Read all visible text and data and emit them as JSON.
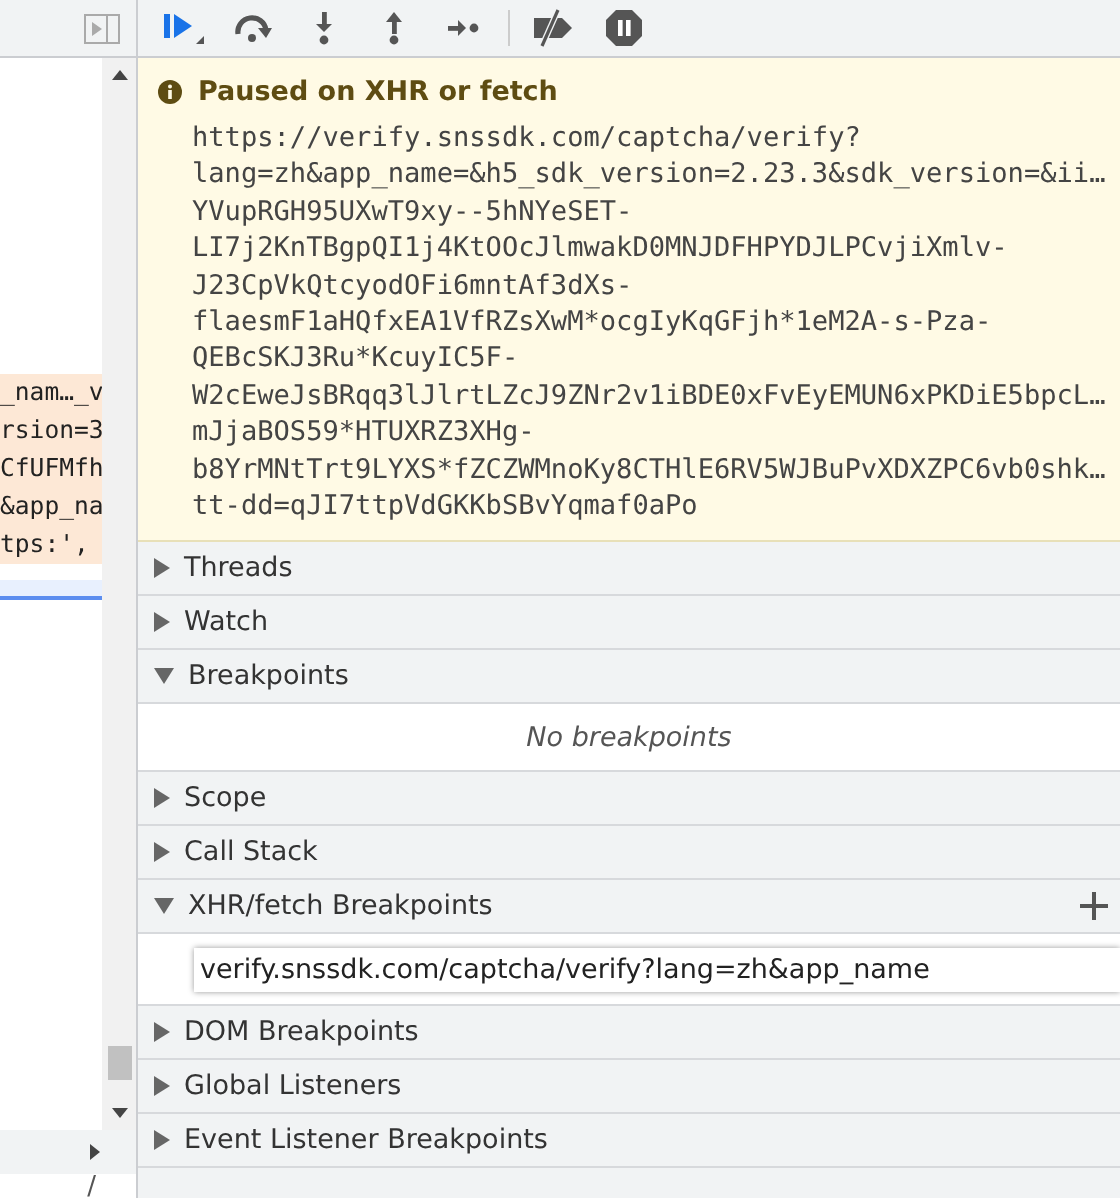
{
  "toolbar": {
    "buttons": [
      {
        "kind": "resume"
      },
      {
        "kind": "step-over"
      },
      {
        "kind": "step-into"
      },
      {
        "kind": "step-out"
      },
      {
        "kind": "step"
      },
      {
        "kind": "deactivate"
      },
      {
        "kind": "pause-exceptions"
      }
    ]
  },
  "code_lines": [
    {
      "text": "_nam…_v",
      "highlighted": true
    },
    {
      "text": "rsion=3",
      "highlighted": true
    },
    {
      "text": "CfUFMfh",
      "highlighted": true
    },
    {
      "text": "&app_na",
      "highlighted": true
    },
    {
      "text": "tps:',",
      "highlighted": true
    }
  ],
  "bottom_left_text": "/",
  "paused": {
    "title": "Paused on XHR or fetch",
    "lines": [
      "https://verify.snssdk.com/captcha/verify?",
      "lang=zh&app_name=&h5_sdk_version=2.23.3&sdk_version=&ii…",
      "YVupRGH95UXwT9xy--5hNYeSET-",
      "LI7j2KnTBgpQI1j4KtOOcJlmwakD0MNJDFHPYDJLPCvjiXmlv-",
      "J23CpVkQtcyodOFi6mntAf3dXs-",
      "flaesmF1aHQfxEA1VfRZsXwM*ocgIyKqGFjh*1eM2A-s-Pza-",
      "QEBcSKJ3Ru*KcuyIC5F-",
      "W2cEweJsBRqq3lJlrtLZcJ9ZNr2v1iBDE0xFvEyEMUN6xPKDiE5bpcL…",
      "mJjaBOS59*HTUXRZ3XHg-",
      "b8YrMNtTrt9LYXS*fZCZWMnoKy8CTHlE6RV5WJBuPvXDXZPC6vb0shk…",
      "tt-dd=qJI7ttpVdGKKbSBvYqmaf0aPo"
    ]
  },
  "sections": [
    {
      "title": "Threads",
      "expanded": false
    },
    {
      "title": "Watch",
      "expanded": false
    },
    {
      "title": "Breakpoints",
      "expanded": true,
      "empty_text": "No breakpoints"
    },
    {
      "title": "Scope",
      "expanded": false
    },
    {
      "title": "Call Stack",
      "expanded": false
    },
    {
      "title": "XHR/fetch Breakpoints",
      "expanded": true,
      "add_button": true,
      "input_value": "verify.snssdk.com/captcha/verify?lang=zh&app_name"
    },
    {
      "title": "DOM Breakpoints",
      "expanded": false
    },
    {
      "title": "Global Listeners",
      "expanded": false
    },
    {
      "title": "Event Listener Breakpoints",
      "expanded": false
    }
  ]
}
